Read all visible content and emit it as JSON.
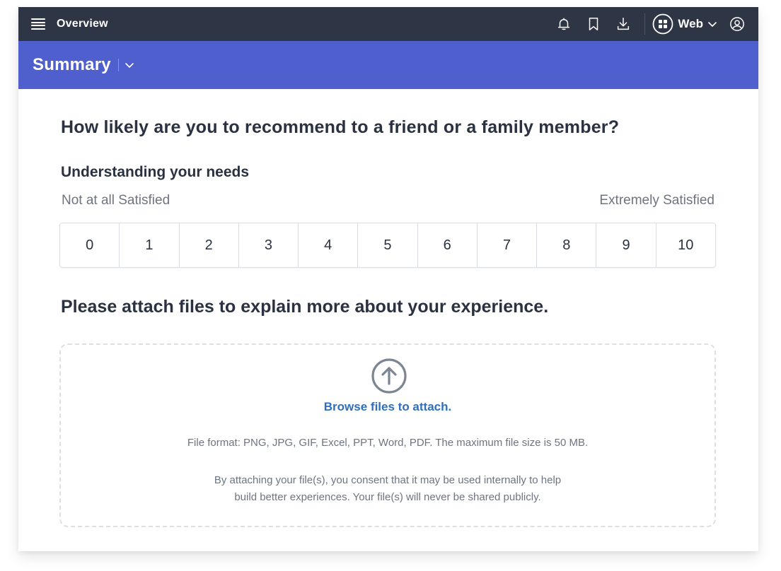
{
  "topbar": {
    "title": "Overview",
    "icons": [
      "menu-icon",
      "bell-icon",
      "bookmark-icon",
      "download-icon",
      "grid-icon",
      "chevron-down-icon",
      "user-icon"
    ],
    "platform_label": "Web"
  },
  "subbar": {
    "title": "Summary"
  },
  "survey": {
    "question": "How likely are you to recommend to a friend or a family member?",
    "subheading": "Understanding your needs",
    "scale_low_label": "Not at all Satisfied",
    "scale_high_label": "Extremely Satisfied",
    "scale_values": [
      "0",
      "1",
      "2",
      "3",
      "4",
      "5",
      "6",
      "7",
      "8",
      "9",
      "10"
    ]
  },
  "attachments": {
    "heading": "Please attach files to explain more about your experience.",
    "browse_label": "Browse files to attach.",
    "file_format_text": "File format: PNG, JPG, GIF, Excel, PPT, Word, PDF. The maximum file size is 50 MB.",
    "consent_line1": "By attaching your file(s), you consent that it may be used internally to help",
    "consent_line2": "build better experiences. Your file(s) will never be shared publicly."
  },
  "colors": {
    "topbar_bg": "#2e3646",
    "accent": "#4f5fcd",
    "link": "#2f6fbd",
    "heading_text": "#2a3140",
    "muted_text": "#6e7480"
  }
}
